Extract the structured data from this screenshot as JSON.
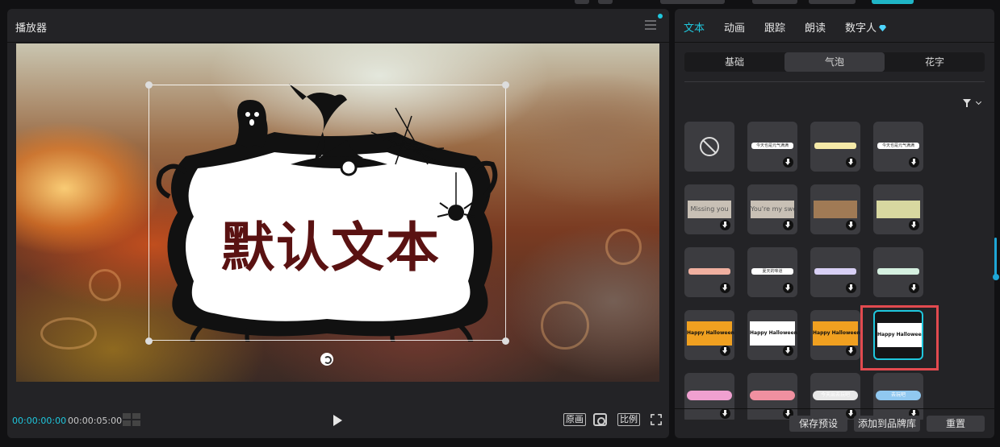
{
  "player": {
    "title": "播放器",
    "overlay_text": "默认文本",
    "time_current": "00:00:00:00",
    "time_total": "00:00:05:00",
    "btn_original": "原画",
    "btn_ratio": "比例"
  },
  "panel": {
    "tabs": [
      "文本",
      "动画",
      "跟踪",
      "朗读",
      "数字人"
    ],
    "subtabs": [
      "基础",
      "气泡",
      "花字"
    ],
    "tiles": [
      {
        "type": "none"
      },
      {
        "type": "bubble",
        "text": "今天也是元气满满"
      },
      {
        "type": "bubble",
        "text": "",
        "color": "#f5e9a8"
      },
      {
        "type": "bubble",
        "text": "今天也是元气满满"
      },
      {
        "type": "paper",
        "text": "Missing you"
      },
      {
        "type": "paper",
        "text": "You're my sweetheart"
      },
      {
        "type": "paper",
        "text": "",
        "color": "#a07a55"
      },
      {
        "type": "paper",
        "text": "",
        "color": "#d8d8a0"
      },
      {
        "type": "bubble",
        "text": "",
        "color": "#f0b0a0"
      },
      {
        "type": "bubble",
        "text": "夏天的味道"
      },
      {
        "type": "bubble",
        "text": "",
        "color": "#d8d0f5"
      },
      {
        "type": "bubble",
        "text": "",
        "color": "#d5f0e0"
      },
      {
        "type": "hw",
        "text": "Happy Halloween",
        "color": "#f0a020"
      },
      {
        "type": "hw",
        "text": "Happy Halloween",
        "color": "#ffffff"
      },
      {
        "type": "hw",
        "text": "Happy Halloween",
        "color": "#f0a020"
      },
      {
        "type": "hw",
        "text": "Happy Halloween",
        "color": "#ffffff",
        "selected": true
      },
      {
        "type": "hearts",
        "text": "",
        "color": "#f0a0d0"
      },
      {
        "type": "hearts",
        "text": "",
        "color": "#f090a0"
      },
      {
        "type": "hearts",
        "text": "今天出去玩吧",
        "color": "#e8e8e8"
      },
      {
        "type": "hearts",
        "text": "去玩吧",
        "color": "#90c8f0"
      }
    ],
    "buttons": {
      "save_preset": "保存预设",
      "add_brand": "添加到品牌库",
      "reset": "重置"
    }
  }
}
